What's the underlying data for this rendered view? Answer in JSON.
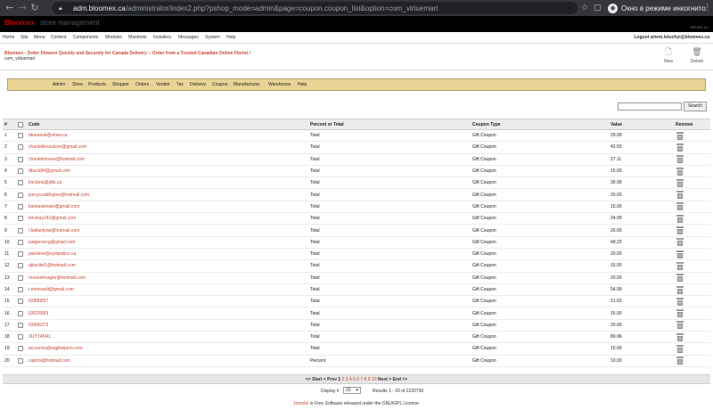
{
  "browser": {
    "url_host": "adm.bloomex.ca",
    "url_path": "/administrator/index2.php?pshop_mode=admin&page=coupon.coupon_list&option=com_virtuemart",
    "incognito_label": "Окно в режиме инкогнито"
  },
  "admin_header": {
    "logo": "Bloomex",
    "logo_sub": "store management",
    "version": "VE1001.12"
  },
  "top_menu": {
    "items": [
      "Home",
      "Site",
      "Menu",
      "Content",
      "Components",
      "Modules",
      "Mambots",
      "Installers",
      "Messages",
      "System",
      "Help"
    ],
    "logout": "Logout artem.letuchyi@bloomex.ca"
  },
  "page": {
    "title": "Bloomex - Order Flowers Quickly and Securely for Canada Delivery :: Order from a Trusted Canadian Online Florist /",
    "subtitle": "com_virtuemart"
  },
  "toolbar": {
    "new_label": "New",
    "delete_label": "Delete"
  },
  "vm_menu": {
    "items": [
      "Admin",
      "Store",
      "Products",
      "Shopper",
      "Orders",
      "Vendor",
      "Tax",
      "Delivery",
      "Coupon",
      "Manufacturer",
      "Warehouse",
      "Help"
    ]
  },
  "search": {
    "value": "",
    "placeholder": "",
    "button_label": "Search"
  },
  "table": {
    "headers": {
      "num": "#",
      "code": "Code",
      "percent_total": "Percent or Total",
      "coupon_type": "Coupon Type",
      "value": "Value",
      "remove": "Remove"
    },
    "rows": [
      {
        "num": "1",
        "code": "bkarasuk@shaw.ca",
        "percent_total": "Total",
        "coupon_type": "Gift Coupon",
        "value": "29.99"
      },
      {
        "num": "2",
        "code": "chantellecoulson@gmail.com",
        "percent_total": "Total",
        "coupon_type": "Gift Coupon",
        "value": "43.53"
      },
      {
        "num": "3",
        "code": "chantelmoses@hotmail.com",
        "percent_total": "Total",
        "coupon_type": "Gift Coupon",
        "value": "27.11"
      },
      {
        "num": "4",
        "code": "dbuck84@gmail.com",
        "percent_total": "Total",
        "coupon_type": "Gift Coupon",
        "value": "15.00"
      },
      {
        "num": "5",
        "code": "jmcfarla@jdtk.ca",
        "percent_total": "Total",
        "coupon_type": "Gift Coupon",
        "value": "39.99"
      },
      {
        "num": "6",
        "code": "joecycuddington@hotmail.com",
        "percent_total": "Total",
        "coupon_type": "Gift Coupon",
        "value": "20.00"
      },
      {
        "num": "7",
        "code": "katinastewart@gmail.com",
        "percent_total": "Total",
        "coupon_type": "Gift Coupon",
        "value": "15.00"
      },
      {
        "num": "8",
        "code": "kmckay241@gmail.com",
        "percent_total": "Total",
        "coupon_type": "Gift Coupon",
        "value": "24.99"
      },
      {
        "num": "9",
        "code": "l.ballantyne@hotmail.com",
        "percent_total": "Total",
        "coupon_type": "Gift Coupon",
        "value": "20.00"
      },
      {
        "num": "10",
        "code": "paigerveng@gmail.com",
        "percent_total": "Total",
        "coupon_type": "Gift Coupon",
        "value": "49.22"
      },
      {
        "num": "11",
        "code": "paoloine@sympatico.ca",
        "percent_total": "Total",
        "coupon_type": "Gift Coupon",
        "value": "20.00"
      },
      {
        "num": "12",
        "code": "qklavitel1@hotmail.com",
        "percent_total": "Total",
        "coupon_type": "Gift Coupon",
        "value": "15.00"
      },
      {
        "num": "13",
        "code": "roxanelmagier@hotmail.com",
        "percent_total": "Total",
        "coupon_type": "Gift Coupon",
        "value": "20.00"
      },
      {
        "num": "14",
        "code": "t.mimeault@gmail.com",
        "percent_total": "Total",
        "coupon_type": "Gift Coupon",
        "value": "54.99"
      },
      {
        "num": "15",
        "code": "02880857",
        "percent_total": "Total",
        "coupon_type": "Gift Coupon",
        "value": "21.62"
      },
      {
        "num": "16",
        "code": "03025883",
        "percent_total": "Total",
        "coupon_type": "Gift Coupon",
        "value": "15.00"
      },
      {
        "num": "17",
        "code": "03466373",
        "percent_total": "Total",
        "coupon_type": "Gift Coupon",
        "value": "20.00"
      },
      {
        "num": "18",
        "code": "0UYT4KRL",
        "percent_total": "Total",
        "coupon_type": "Gift Coupon",
        "value": "89.96"
      },
      {
        "num": "19",
        "code": "accounts@egghelpers.com",
        "percent_total": "Total",
        "coupon_type": "Gift Coupon",
        "value": "15.00"
      },
      {
        "num": "20",
        "code": "caprini@hotmail.com",
        "percent_total": "Percent",
        "coupon_type": "Gift Coupon",
        "value": "10.00"
      }
    ]
  },
  "pagination": {
    "start": "<< Start",
    "prev": "< Prev",
    "current": "1",
    "pages": [
      "2",
      "3",
      "4",
      "5",
      "6",
      "7",
      "8",
      "9",
      "10"
    ],
    "next": "Next >",
    "end": "End >>"
  },
  "display": {
    "label": "Display #",
    "selected": "20",
    "results": "Results 1 - 20 of 2220750"
  },
  "footer": {
    "link": "Joomla!",
    "text": " is Free Software released under the GNU/GPL License."
  }
}
